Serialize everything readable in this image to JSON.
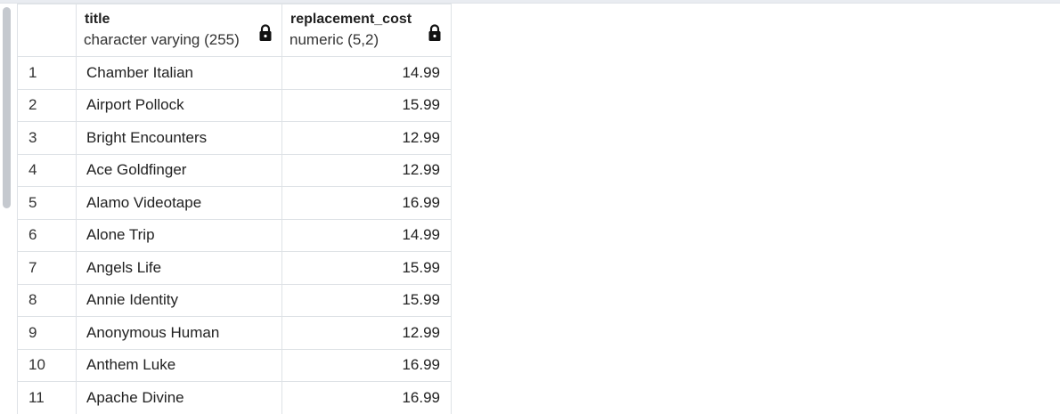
{
  "columns": [
    {
      "name": "title",
      "type": "character varying (255)",
      "locked": true
    },
    {
      "name": "replacement_cost",
      "type": "numeric (5,2)",
      "locked": true
    }
  ],
  "rows": [
    {
      "num": "1",
      "title": "Chamber Italian",
      "cost": "14.99"
    },
    {
      "num": "2",
      "title": "Airport Pollock",
      "cost": "15.99"
    },
    {
      "num": "3",
      "title": "Bright Encounters",
      "cost": "12.99"
    },
    {
      "num": "4",
      "title": "Ace Goldfinger",
      "cost": "12.99"
    },
    {
      "num": "5",
      "title": "Alamo Videotape",
      "cost": "16.99"
    },
    {
      "num": "6",
      "title": "Alone Trip",
      "cost": "14.99"
    },
    {
      "num": "7",
      "title": "Angels Life",
      "cost": "15.99"
    },
    {
      "num": "8",
      "title": "Annie Identity",
      "cost": "15.99"
    },
    {
      "num": "9",
      "title": "Anonymous Human",
      "cost": "12.99"
    },
    {
      "num": "10",
      "title": "Anthem Luke",
      "cost": "16.99"
    },
    {
      "num": "11",
      "title": "Apache Divine",
      "cost": "16.99"
    }
  ],
  "icons": {
    "lock": "lock-icon"
  },
  "colors": {
    "grid_border": "#dee2e6",
    "scroll_thumb": "#c5c9cf"
  }
}
